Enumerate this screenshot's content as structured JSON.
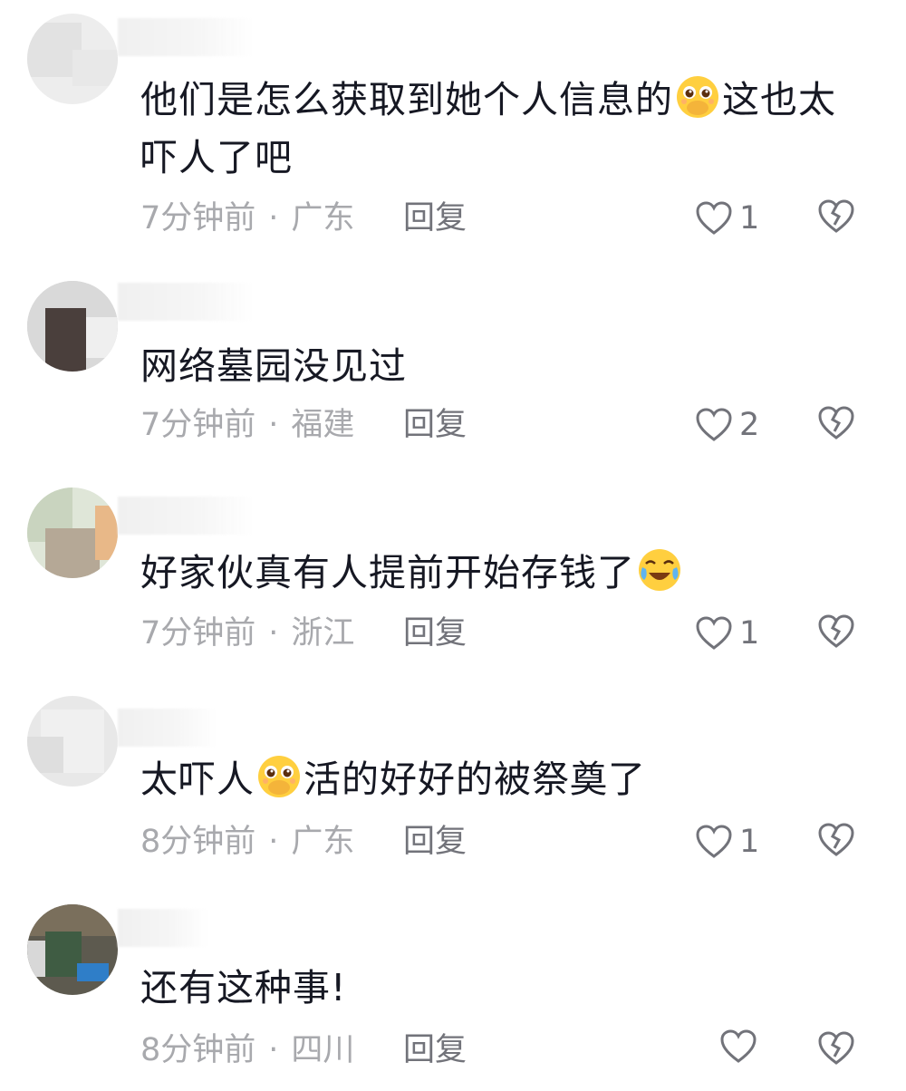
{
  "reply_label": "回复",
  "colors": {
    "text": "#161823",
    "meta": "#a8a9ad",
    "action": "#72737a"
  },
  "comments": [
    {
      "line1": "他们是怎么获取到她个人信息的",
      "line1_after_emoji": "这也太",
      "line2": "吓人了吧",
      "emoji": "covering-mouth-face",
      "time": "7分钟前",
      "location": "广东",
      "likes": "1"
    },
    {
      "line1": "网络墓园没见过",
      "time": "7分钟前",
      "location": "福建",
      "likes": "2"
    },
    {
      "line1": "好家伙真有人提前开始存钱了",
      "emoji": "tears-of-joy-face",
      "time": "7分钟前",
      "location": "浙江",
      "likes": "1"
    },
    {
      "line1": "太吓人",
      "line1_after_emoji": "活的好好的被祭奠了",
      "emoji": "covering-mouth-face",
      "time": "8分钟前",
      "location": "广东",
      "likes": "1"
    },
    {
      "line1": "还有这种事!",
      "time": "8分钟前",
      "location": "四川",
      "likes": ""
    }
  ]
}
